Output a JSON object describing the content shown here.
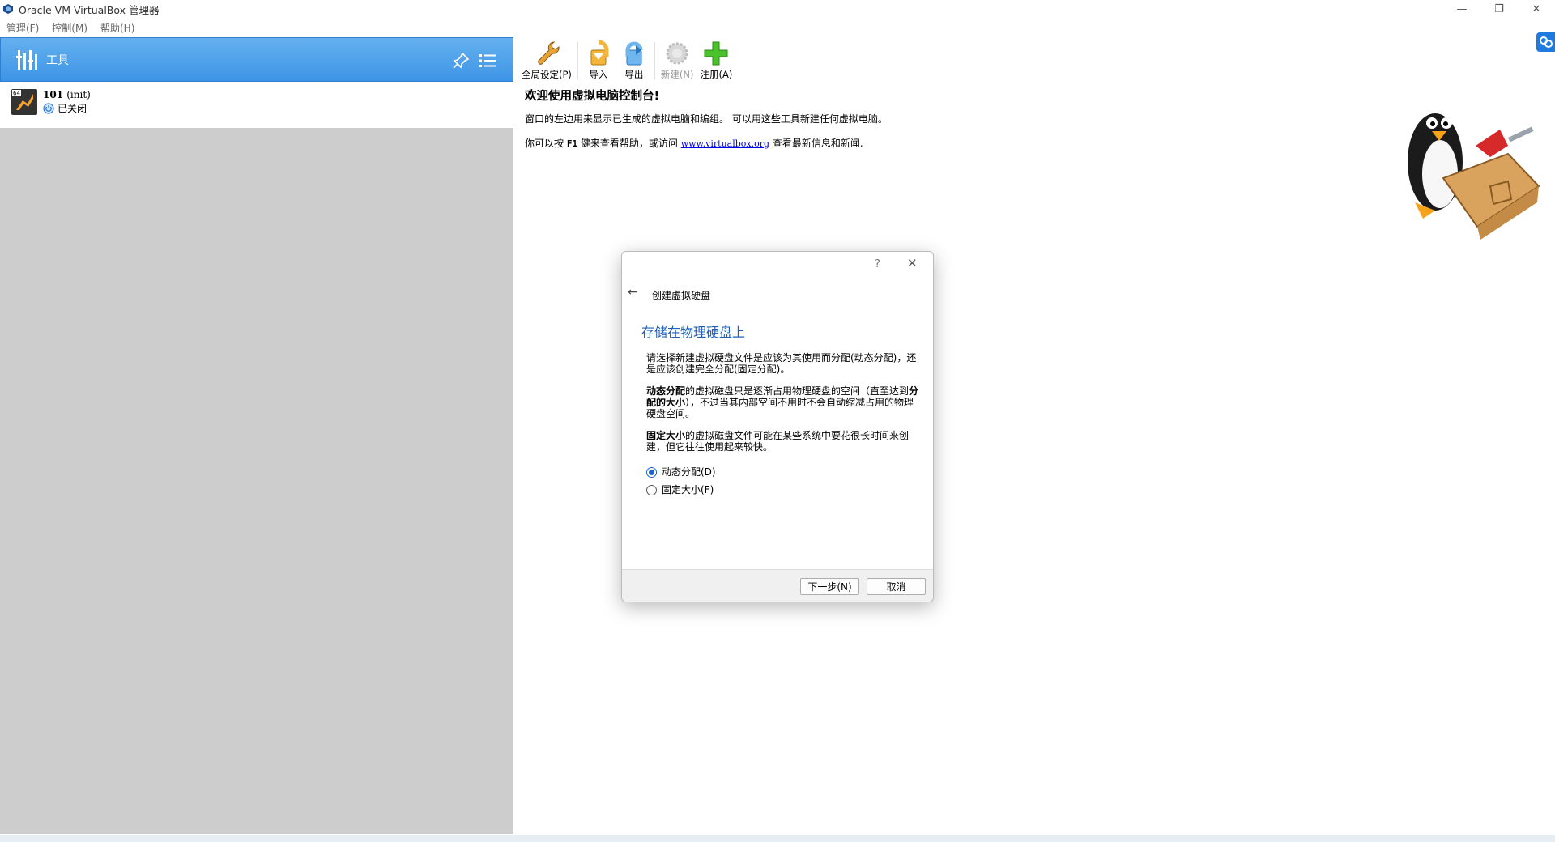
{
  "window": {
    "title": "Oracle VM VirtualBox 管理器",
    "controls": {
      "minimize": "—",
      "restore": "❐",
      "close": "✕"
    }
  },
  "menubar": [
    "管理(F)",
    "控制(M)",
    "帮助(H)"
  ],
  "tools": {
    "label": "工具"
  },
  "vm_list": [
    {
      "name": "101",
      "snapshot": "(init)",
      "status": "已关闭",
      "os_badge": "64"
    }
  ],
  "toolbar": {
    "global_settings": "全局设定(P)",
    "import": "导入",
    "export": "导出",
    "new": "新建(N)",
    "register": "注册(A)"
  },
  "welcome": {
    "title": "欢迎使用虚拟电脑控制台!",
    "line1": "窗口的左边用来显示已生成的虚拟电脑和编组。 可以用这些工具新建任何虚拟电脑。",
    "line2_pre": "你可以按 ",
    "line2_key": "F1",
    "line2_mid": " 健来查看帮助，或访问 ",
    "line2_link": "www.virtualbox.org",
    "line2_post": " 查看最新信息和新闻."
  },
  "dialog": {
    "help": "?",
    "close": "✕",
    "back": "←",
    "title": "创建虚拟硬盘",
    "heading": "存储在物理硬盘上",
    "para1": "请选择新建虚拟硬盘文件是应该为其使用而分配(动态分配)，还是应该创建完全分配(固定分配)。",
    "para2_bold1": "动态分配",
    "para2_a": "的虚拟磁盘只是逐渐占用物理硬盘的空间（直至达到",
    "para2_bold2": "分配的大小",
    "para2_b": "），不过当其内部空间不用时不会自动缩减占用的物理硬盘空间。",
    "para3_bold": "固定大小",
    "para3": "的虚拟磁盘文件可能在某些系统中要花很长时间来创建，但它往往使用起来较快。",
    "options": [
      {
        "label": "动态分配(D)",
        "checked": true
      },
      {
        "label": "固定大小(F)",
        "checked": false
      }
    ],
    "next_button": "下一步(N)",
    "cancel_button": "取消"
  }
}
